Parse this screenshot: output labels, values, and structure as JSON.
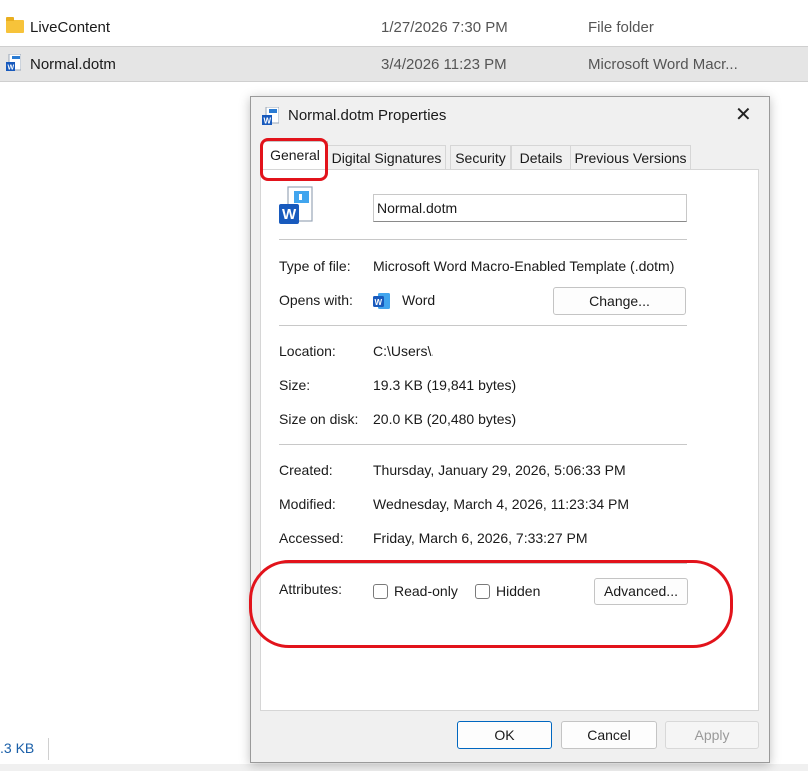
{
  "explorer": {
    "rows": [
      {
        "name": "LiveContent",
        "date": "1/27/2026 7:30 PM",
        "type": "File folder",
        "icon": "folder-icon"
      },
      {
        "name": "Normal.dotm",
        "date": "3/4/2026 11:23 PM",
        "type": "Microsoft Word Macr...",
        "icon": "word-file-icon"
      }
    ],
    "status_size": ".3 KB"
  },
  "dialog": {
    "title": "Normal.dotm Properties",
    "close_glyph": "✕",
    "tabs": [
      "General",
      "Digital Signatures",
      "Security",
      "Details",
      "Previous Versions"
    ],
    "active_tab": "General",
    "file_name": "Normal.dotm",
    "type_label": "Type of file:",
    "type_value": "Microsoft Word Macro-Enabled Template (.dotm)",
    "opens_label": "Opens with:",
    "opens_value": "Word",
    "change_button": "Change...",
    "location_label": "Location:",
    "location_value": "C:\\Users\\.",
    "size_label": "Size:",
    "size_value": "19.3 KB (19,841 bytes)",
    "size_disk_label": "Size on disk:",
    "size_disk_value": "20.0 KB (20,480 bytes)",
    "created_label": "Created:",
    "created_value": "Thursday, January 29, 2026, 5:06:33 PM",
    "modified_label": "Modified:",
    "modified_value": "Wednesday, March 4, 2026, 11:23:34 PM",
    "accessed_label": "Accessed:",
    "accessed_value": "Friday, March 6, 2026, 7:33:27 PM",
    "attributes_label": "Attributes:",
    "readonly_label": "Read-only",
    "readonly_checked": false,
    "hidden_label": "Hidden",
    "hidden_checked": false,
    "advanced_button": "Advanced...",
    "ok_button": "OK",
    "cancel_button": "Cancel",
    "apply_button": "Apply"
  },
  "colors": {
    "highlight_red": "#e2131b",
    "word_blue": "#185abd",
    "accent": "#0067c0"
  }
}
